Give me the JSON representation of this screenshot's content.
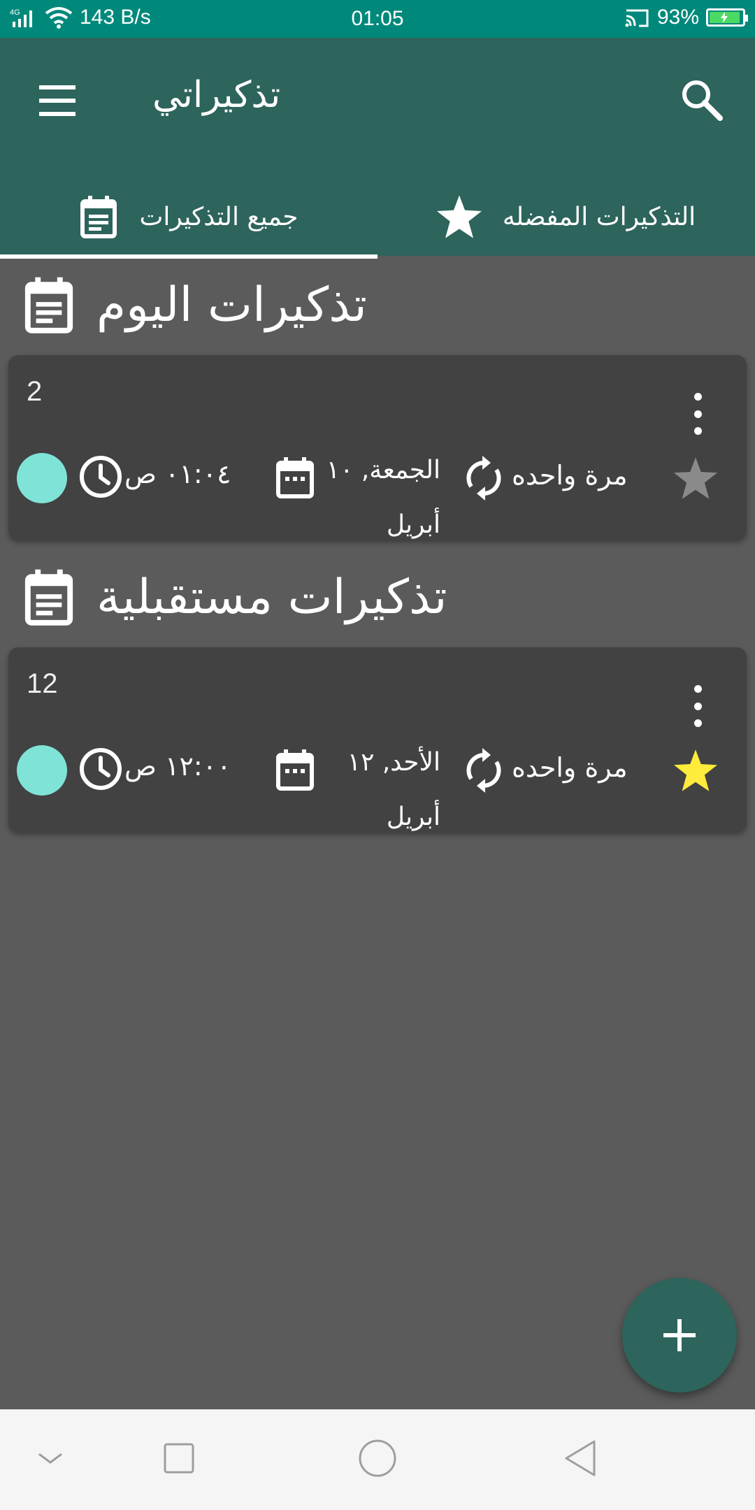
{
  "status_bar": {
    "network": "4G",
    "speed": "143 B/s",
    "time": "01:05",
    "battery": "93%",
    "battery_level": 0.93
  },
  "app_bar": {
    "title": "تذكيراتي",
    "menu_icon": "hamburger-menu-icon",
    "search_icon": "search-icon"
  },
  "tabs": [
    {
      "label": "جميع التذكيرات",
      "icon": "note-calendar-icon",
      "selected": true
    },
    {
      "label": "التذكيرات المفضله",
      "icon": "star-icon",
      "selected": false
    }
  ],
  "sections": [
    {
      "title": "تذكيرات اليوم",
      "reminders": [
        {
          "title": "2",
          "repeat": "مرة واحده",
          "date": "الجمعة, ١٠ أبريل",
          "time": "٠١:٠٤ ص",
          "favorite": false,
          "color": "#7fe3d8"
        }
      ]
    },
    {
      "title": "تذكيرات مستقبلية",
      "reminders": [
        {
          "title": "12",
          "repeat": "مرة واحده",
          "date": "الأحد, ١٢ أبريل",
          "time": "١٢:٠٠ ص",
          "favorite": true,
          "color": "#7fe3d8"
        }
      ]
    }
  ],
  "fab": {
    "icon": "plus-icon"
  },
  "colors": {
    "status_bar": "#00897b",
    "primary": "#2d645c",
    "background": "#5b5b5b",
    "card": "#424242",
    "favorite_star": "#ffeb3b",
    "unfavorite_star": "#8a8a8a",
    "reminder_color": "#7fe3d8"
  },
  "nav_bar": {
    "buttons": [
      "collapse-icon",
      "recents-icon",
      "home-icon",
      "back-icon"
    ]
  }
}
